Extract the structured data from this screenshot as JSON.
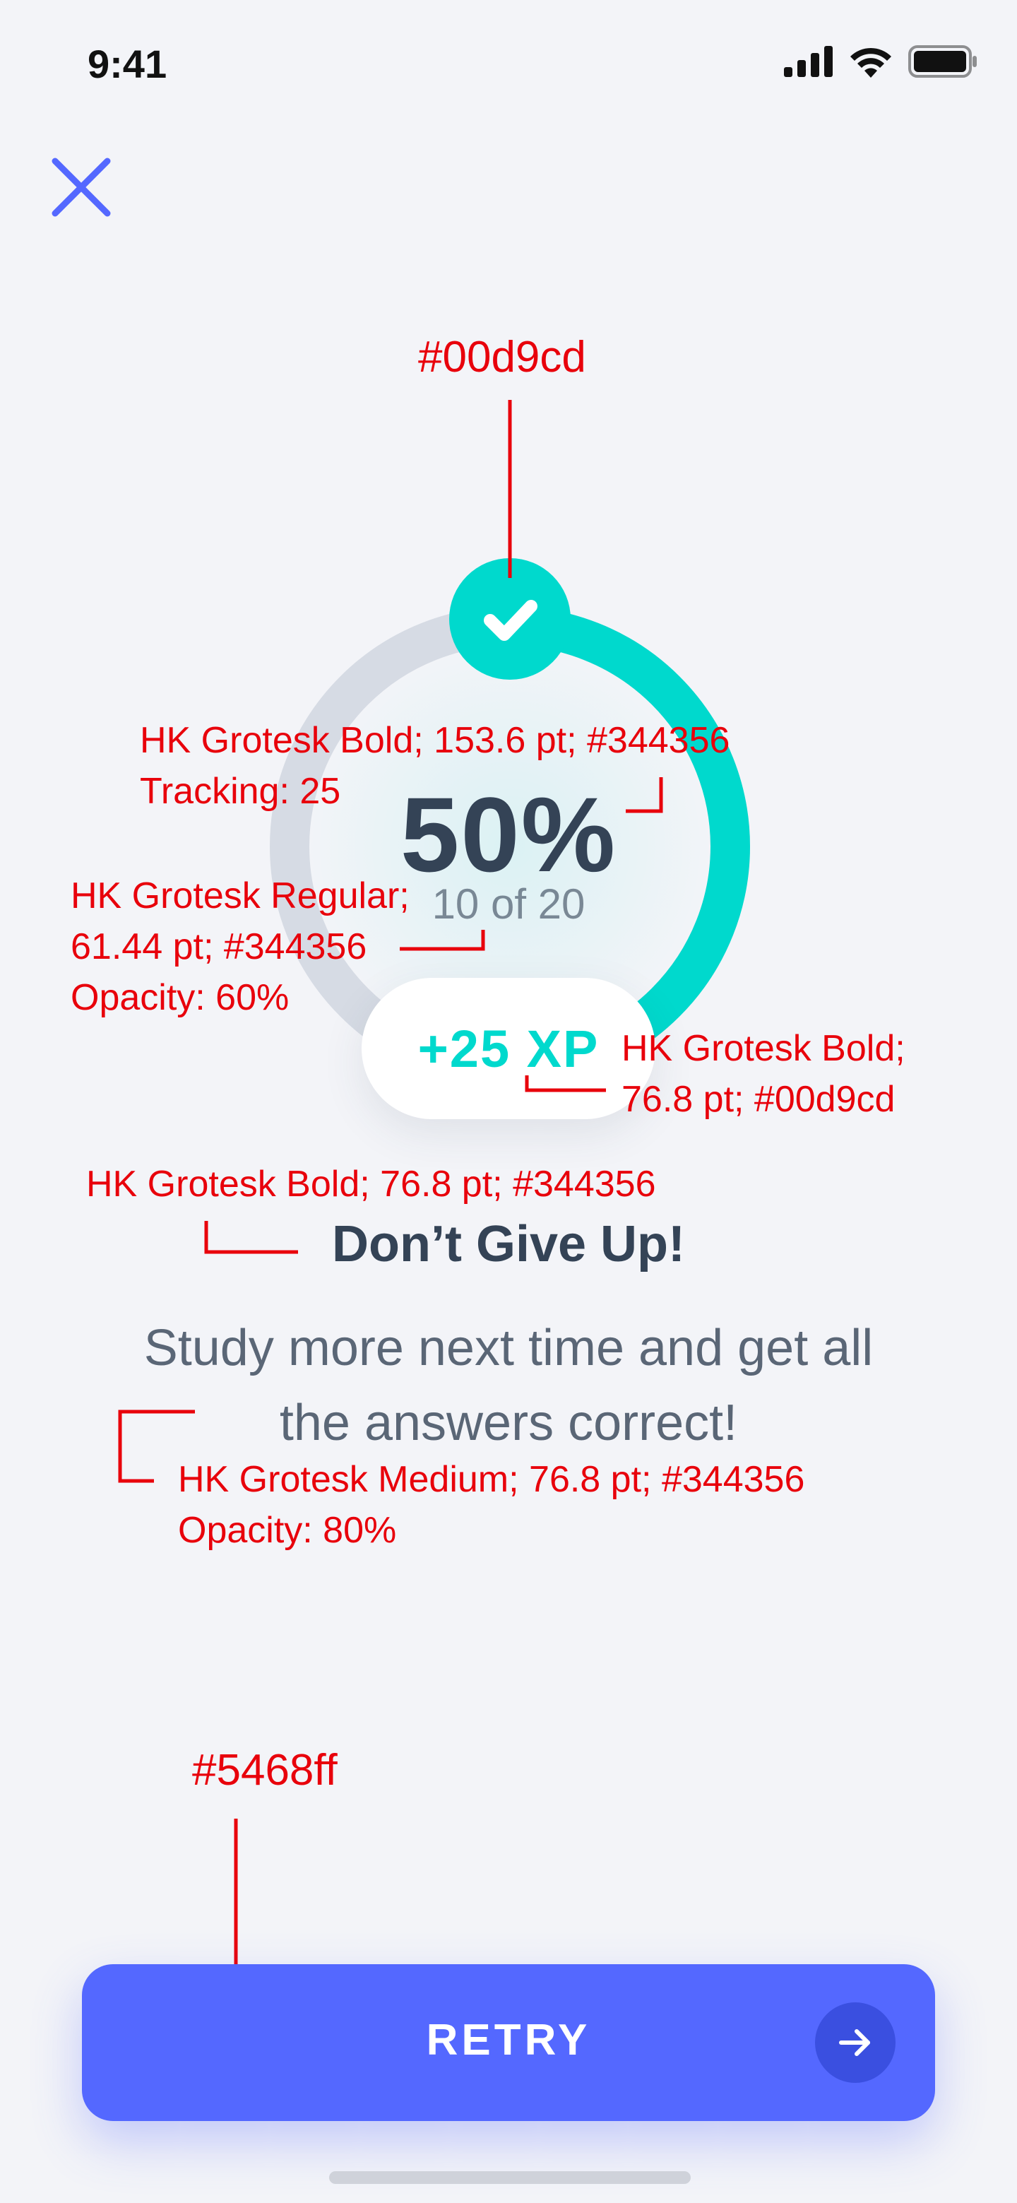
{
  "status_bar": {
    "time": "9:41"
  },
  "progress": {
    "fraction": 0.5,
    "percent_label": "50%",
    "count_label": "10 of 20"
  },
  "xp": {
    "label": "+25 XP"
  },
  "message": {
    "headline": "Don’t Give Up!",
    "body": "Study more next time and get all the answers correct!"
  },
  "retry_button": {
    "label": "RETRY"
  },
  "colors": {
    "accent": "#00d9cd",
    "text": "#344356",
    "primary": "#5468ff",
    "track": "#d6dbe4",
    "background": "#f3f4f8",
    "annotation": "#e8000b"
  },
  "icons": [
    "close-icon",
    "check-icon",
    "arrow-right-icon",
    "signal-icon",
    "wifi-icon",
    "battery-icon"
  ],
  "annotations": {
    "check_color": "#00d9cd",
    "percent_font_1": "HK Grotesk Bold; 153.6 pt; #344356",
    "percent_font_2": "Tracking: 25",
    "count_font_1": "HK Grotesk Regular;",
    "count_font_2": "61.44 pt; #344356",
    "count_font_3": "Opacity: 60%",
    "xp_font_1": "HK Grotesk Bold;",
    "xp_font_2": "76.8 pt; #00d9cd",
    "headline_font": "HK Grotesk Bold; 76.8 pt; #344356",
    "body_font_1": "HK Grotesk Medium; 76.8 pt; #344356",
    "body_font_2": "Opacity: 80%",
    "button_color": "#5468ff"
  }
}
